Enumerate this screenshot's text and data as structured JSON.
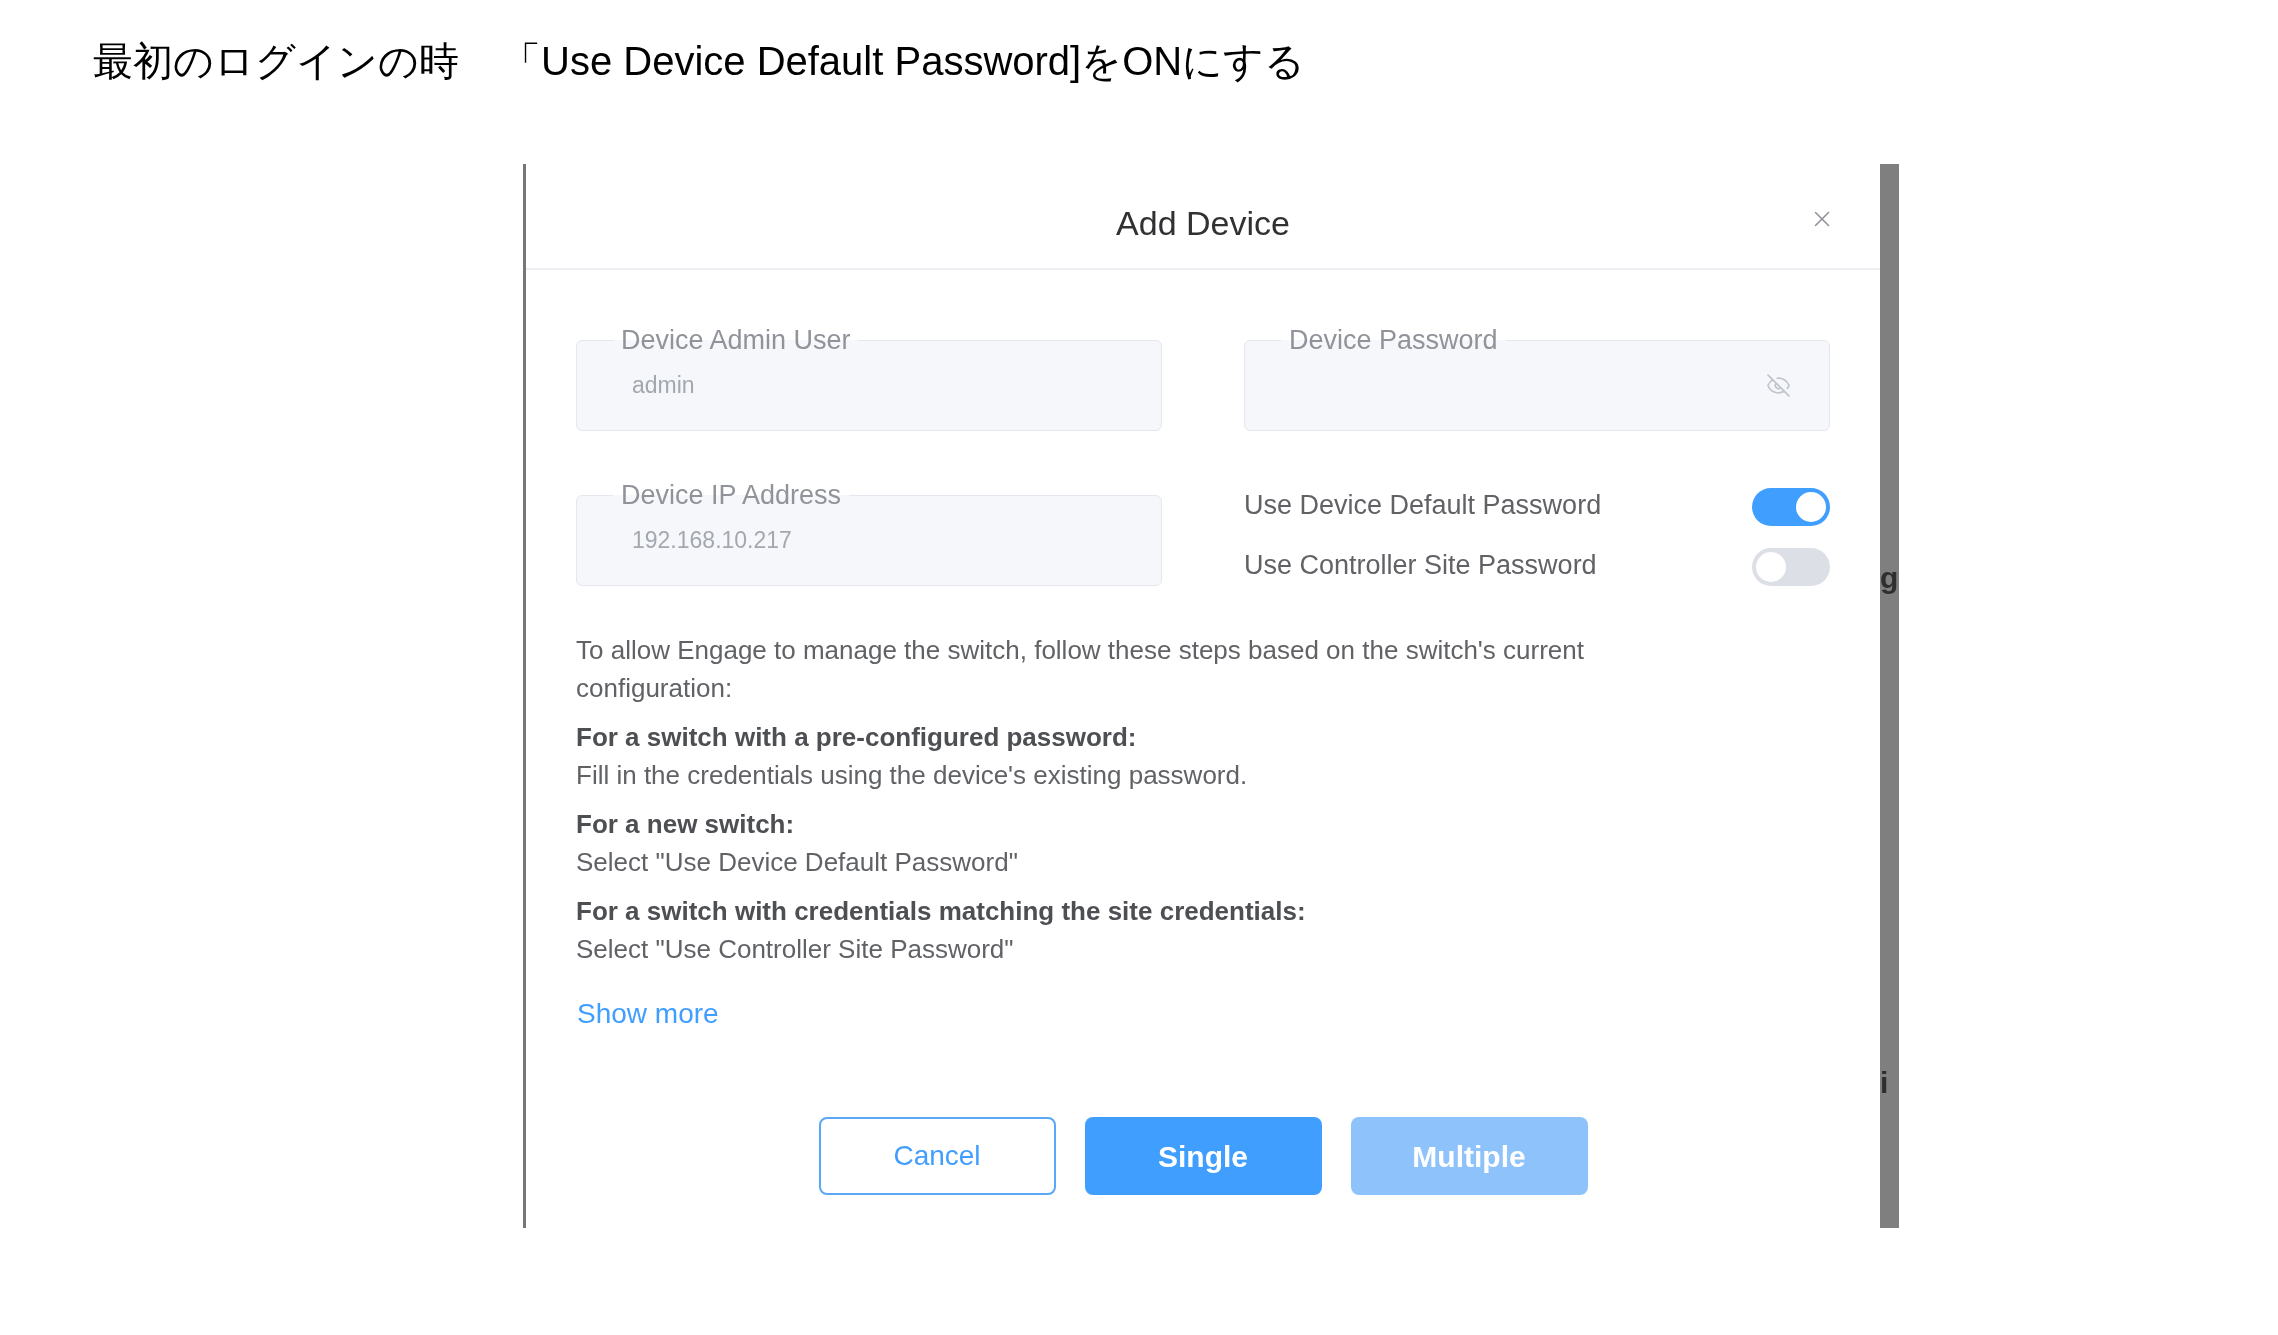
{
  "caption": {
    "label": "最初のログインの時",
    "instruction": "「Use Device Default Password]をONにする"
  },
  "dialog": {
    "title": "Add Device",
    "fields": [
      {
        "label": "Device Admin User",
        "placeholder": "admin",
        "kind": "text",
        "disabled": true
      },
      {
        "label": "Device Password",
        "kind": "password",
        "disabled": true
      },
      {
        "label": "Device IP Address",
        "placeholder": "192.168.10.217",
        "kind": "text",
        "disabled": true
      }
    ],
    "toggles": [
      {
        "label": "Use Device Default Password",
        "on": true
      },
      {
        "label": "Use Controller Site Password",
        "on": false
      }
    ],
    "intro": "To allow Engage to manage the switch, follow these steps based on the switch's current configuration:",
    "cases": [
      {
        "heading": "For a switch with a pre-configured password:",
        "text": "Fill in the credentials using the device's existing password."
      },
      {
        "heading": "For a new switch:",
        "text": "Select \"Use Device Default Password\""
      },
      {
        "heading": "For a switch with credentials matching the site credentials:",
        "text": "Select \"Use Controller Site Password\""
      }
    ],
    "show_more": "Show more",
    "buttons": [
      {
        "label": "Cancel",
        "kind": "outline",
        "disabled": false
      },
      {
        "label": "Single",
        "kind": "primary",
        "disabled": false
      },
      {
        "label": "Multiple",
        "kind": "primary",
        "disabled": true
      }
    ]
  },
  "background_fragments": [
    "g",
    "i"
  ]
}
